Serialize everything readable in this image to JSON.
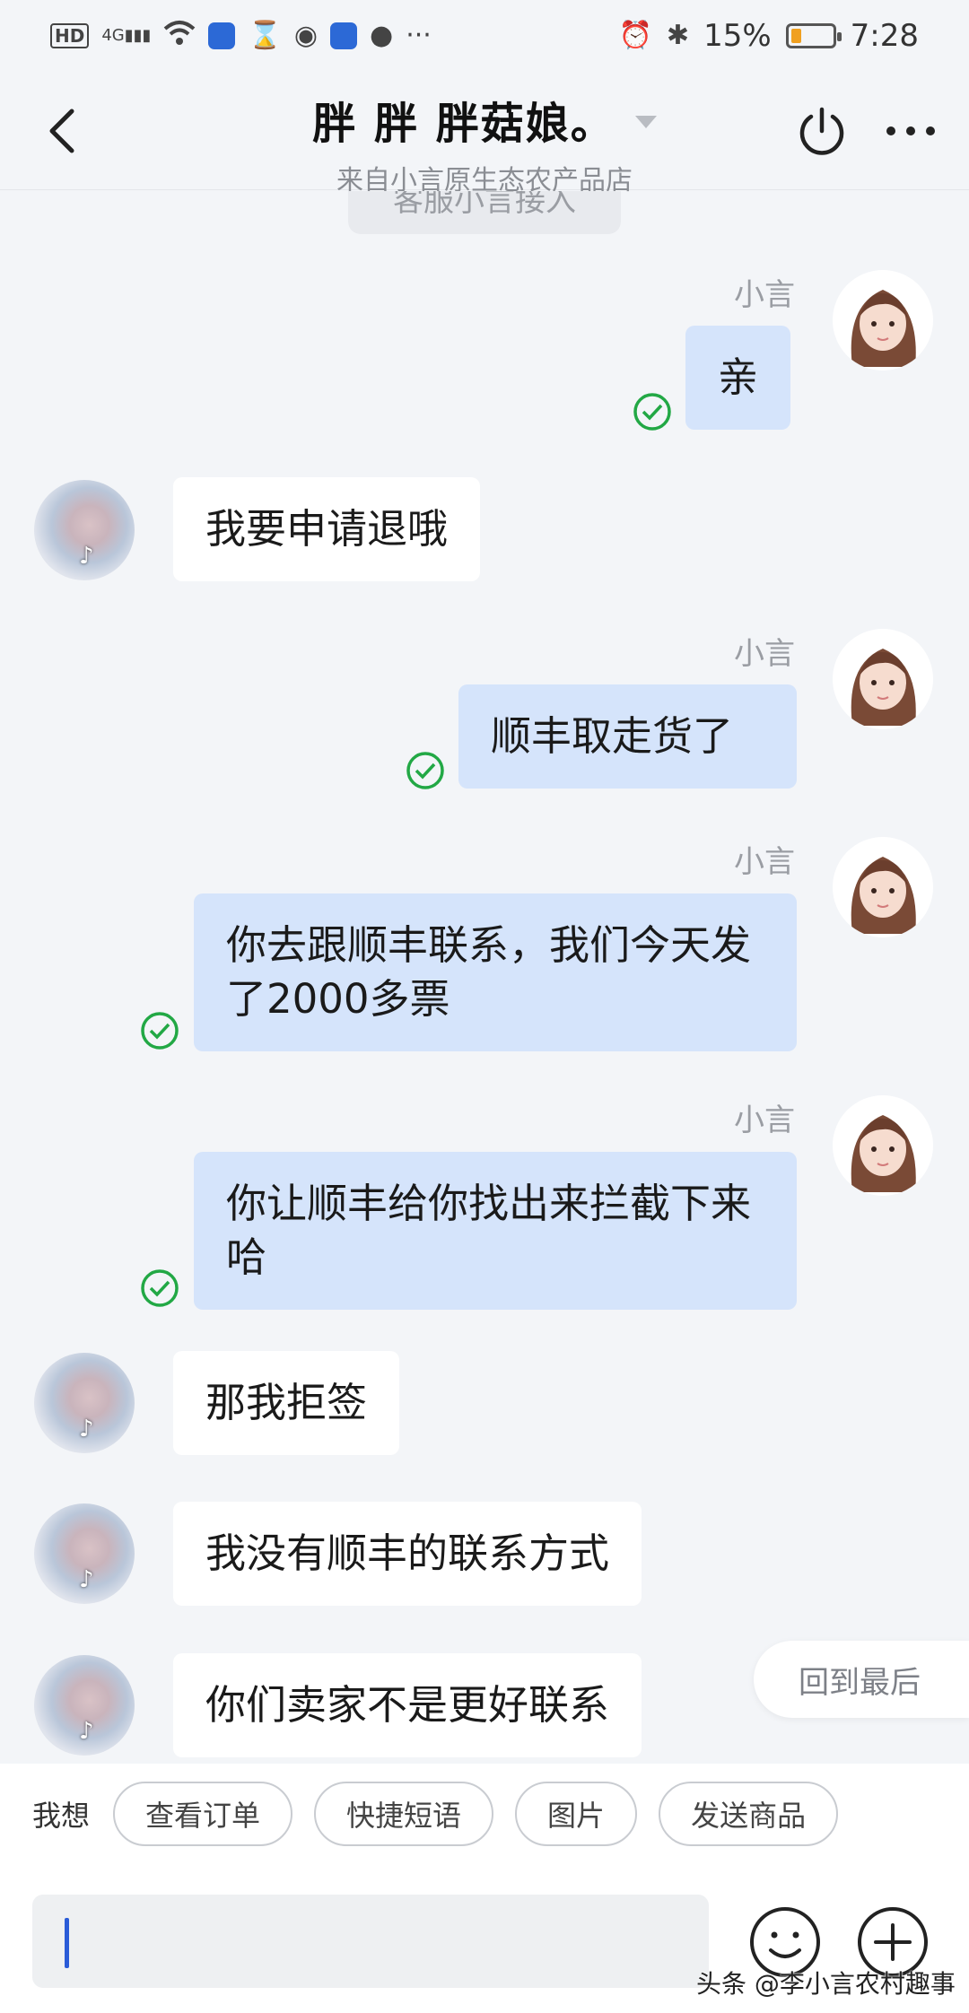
{
  "status_bar": {
    "hd": "HD",
    "network": "4G",
    "battery_percent": "15%",
    "battery_level": 0.15,
    "time": "7:28"
  },
  "header": {
    "title": "胖 胖 胖菇娘。",
    "subtitle": "来自小言原生态农产品店"
  },
  "system_tip": "客服小言接入",
  "messages": [
    {
      "side": "seller",
      "name": "小言",
      "text": "亲",
      "read": true
    },
    {
      "side": "buyer",
      "text": "我要申请退哦"
    },
    {
      "side": "seller",
      "name": "小言",
      "text": "顺丰取走货了",
      "read": true
    },
    {
      "side": "seller",
      "name": "小言",
      "text": "你去跟顺丰联系，我们今天发了2000多票",
      "read": true
    },
    {
      "side": "seller",
      "name": "小言",
      "text": "你让顺丰给你找出来拦截下来哈",
      "read": true
    },
    {
      "side": "buyer",
      "text": "那我拒签"
    },
    {
      "side": "buyer",
      "text": "我没有顺丰的联系方式"
    },
    {
      "side": "buyer",
      "text": "你们卖家不是更好联系"
    }
  ],
  "back_to_latest": "回到最后",
  "quick_bar": {
    "label": "我想",
    "chips": [
      "查看订单",
      "快捷短语",
      "图片",
      "发送商品"
    ]
  },
  "input": {
    "value": ""
  },
  "watermark": "头条 @李小言农村趣事",
  "colors": {
    "seller_bubble": "#d5e4fb",
    "buyer_bubble": "#ffffff",
    "read_check": "#22a845",
    "background": "#f3f5f8"
  }
}
